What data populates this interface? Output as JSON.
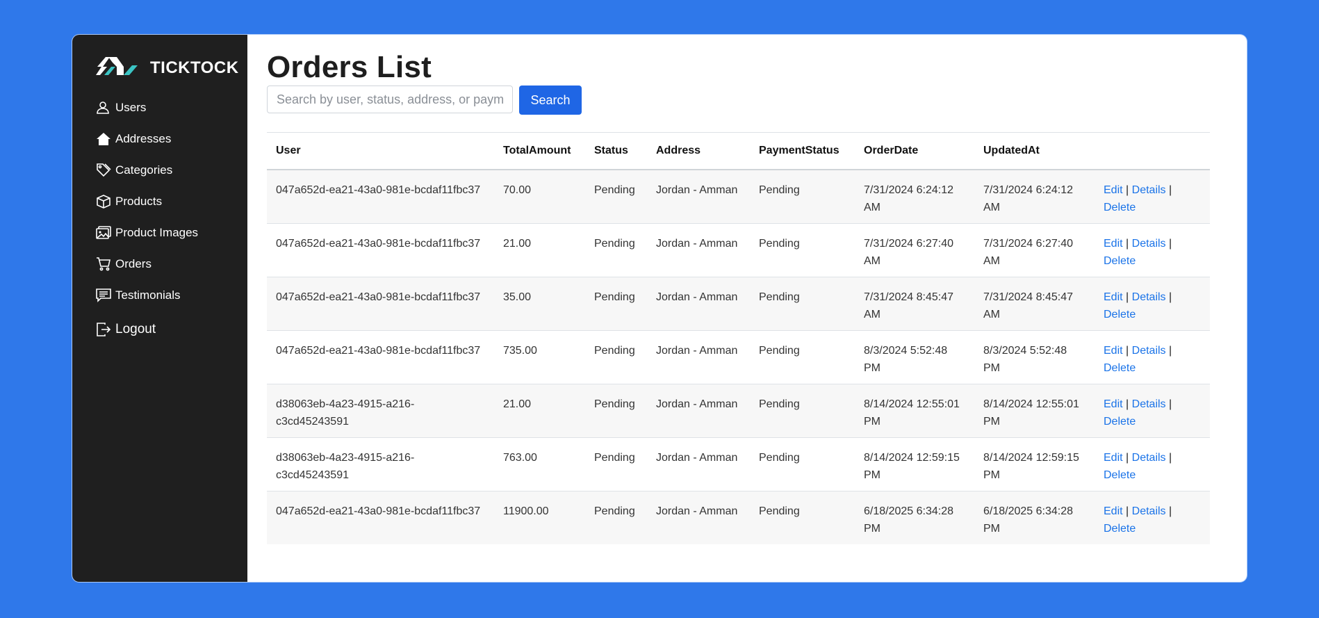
{
  "brand": {
    "name": "TICKTOCK",
    "logo_color_a": "#ffffff",
    "logo_color_b": "#3bc4c4"
  },
  "sidebar": {
    "items": [
      {
        "label": "Users",
        "icon": "user-icon"
      },
      {
        "label": "Addresses",
        "icon": "home-icon"
      },
      {
        "label": "Categories",
        "icon": "tags-icon"
      },
      {
        "label": "Products",
        "icon": "box-icon"
      },
      {
        "label": "Product Images",
        "icon": "images-icon"
      },
      {
        "label": "Orders",
        "icon": "cart-icon"
      },
      {
        "label": "Testimonials",
        "icon": "chat-icon"
      }
    ],
    "logout_label": "Logout"
  },
  "page": {
    "title": "Orders List"
  },
  "search": {
    "placeholder": "Search by user, status, address, or payment status",
    "value": "",
    "button_label": "Search"
  },
  "table": {
    "columns": [
      "User",
      "TotalAmount",
      "Status",
      "Address",
      "PaymentStatus",
      "OrderDate",
      "UpdatedAt",
      ""
    ],
    "rows": [
      {
        "user": "047a652d-ea21-43a0-981e-bcdaf11fbc37",
        "total": "70.00",
        "status": "Pending",
        "address": "Jordan - Amman",
        "payment": "Pending",
        "order_date": "7/31/2024 6:24:12 AM",
        "updated_at": "7/31/2024 6:24:12 AM"
      },
      {
        "user": "047a652d-ea21-43a0-981e-bcdaf11fbc37",
        "total": "21.00",
        "status": "Pending",
        "address": "Jordan - Amman",
        "payment": "Pending",
        "order_date": "7/31/2024 6:27:40 AM",
        "updated_at": "7/31/2024 6:27:40 AM"
      },
      {
        "user": "047a652d-ea21-43a0-981e-bcdaf11fbc37",
        "total": "35.00",
        "status": "Pending",
        "address": "Jordan - Amman",
        "payment": "Pending",
        "order_date": "7/31/2024 8:45:47 AM",
        "updated_at": "7/31/2024 8:45:47 AM"
      },
      {
        "user": "047a652d-ea21-43a0-981e-bcdaf11fbc37",
        "total": "735.00",
        "status": "Pending",
        "address": "Jordan - Amman",
        "payment": "Pending",
        "order_date": "8/3/2024 5:52:48 PM",
        "updated_at": "8/3/2024 5:52:48 PM"
      },
      {
        "user": "d38063eb-4a23-4915-a216-c3cd45243591",
        "total": "21.00",
        "status": "Pending",
        "address": "Jordan - Amman",
        "payment": "Pending",
        "order_date": "8/14/2024 12:55:01 PM",
        "updated_at": "8/14/2024 12:55:01 PM"
      },
      {
        "user": "d38063eb-4a23-4915-a216-c3cd45243591",
        "total": "763.00",
        "status": "Pending",
        "address": "Jordan - Amman",
        "payment": "Pending",
        "order_date": "8/14/2024 12:59:15 PM",
        "updated_at": "8/14/2024 12:59:15 PM"
      },
      {
        "user": "047a652d-ea21-43a0-981e-bcdaf11fbc37",
        "total": "11900.00",
        "status": "Pending",
        "address": "Jordan - Amman",
        "payment": "Pending",
        "order_date": "6/18/2025 6:34:28 PM",
        "updated_at": "6/18/2025 6:34:28 PM"
      }
    ],
    "actions": {
      "edit": "Edit",
      "details": "Details",
      "delete": "Delete",
      "separator": "|"
    }
  },
  "colors": {
    "background": "#2f78ea",
    "sidebar": "#1f1f1f",
    "accent": "#1f66e5",
    "link": "#1a73e8"
  }
}
